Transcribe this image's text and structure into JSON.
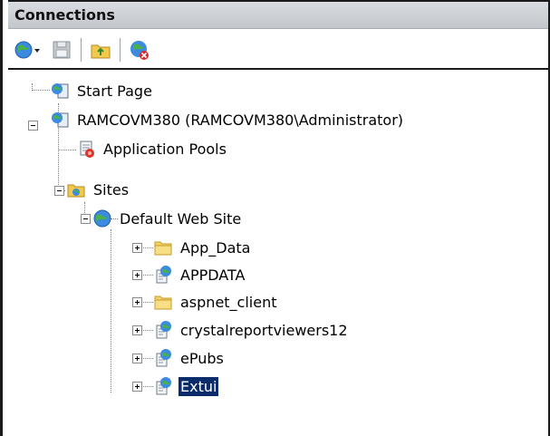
{
  "header": {
    "title": "Connections"
  },
  "toolbar": {
    "buttons": [
      {
        "icon": "connect-globe-icon"
      },
      {
        "icon": "save-disk-icon"
      },
      {
        "icon": "folder-up-icon"
      },
      {
        "icon": "disconnect-globe-icon"
      }
    ]
  },
  "tree": {
    "start_page": "Start Page",
    "server": "RAMCOVM380 (RAMCOVM380\\Administrator)",
    "app_pools": "Application Pools",
    "sites": "Sites",
    "default_site": "Default Web Site",
    "children": [
      {
        "label": "App_Data",
        "icon": "folder-icon"
      },
      {
        "label": "APPDATA",
        "icon": "web-application-icon"
      },
      {
        "label": "aspnet_client",
        "icon": "folder-icon"
      },
      {
        "label": "crystalreportviewers12",
        "icon": "web-application-icon"
      },
      {
        "label": "ePubs",
        "icon": "web-application-icon"
      },
      {
        "label": "Extui",
        "icon": "web-application-icon",
        "selected": true
      }
    ]
  },
  "colors": {
    "selection": "#0b2c6b",
    "header": "#c9cdd2"
  }
}
